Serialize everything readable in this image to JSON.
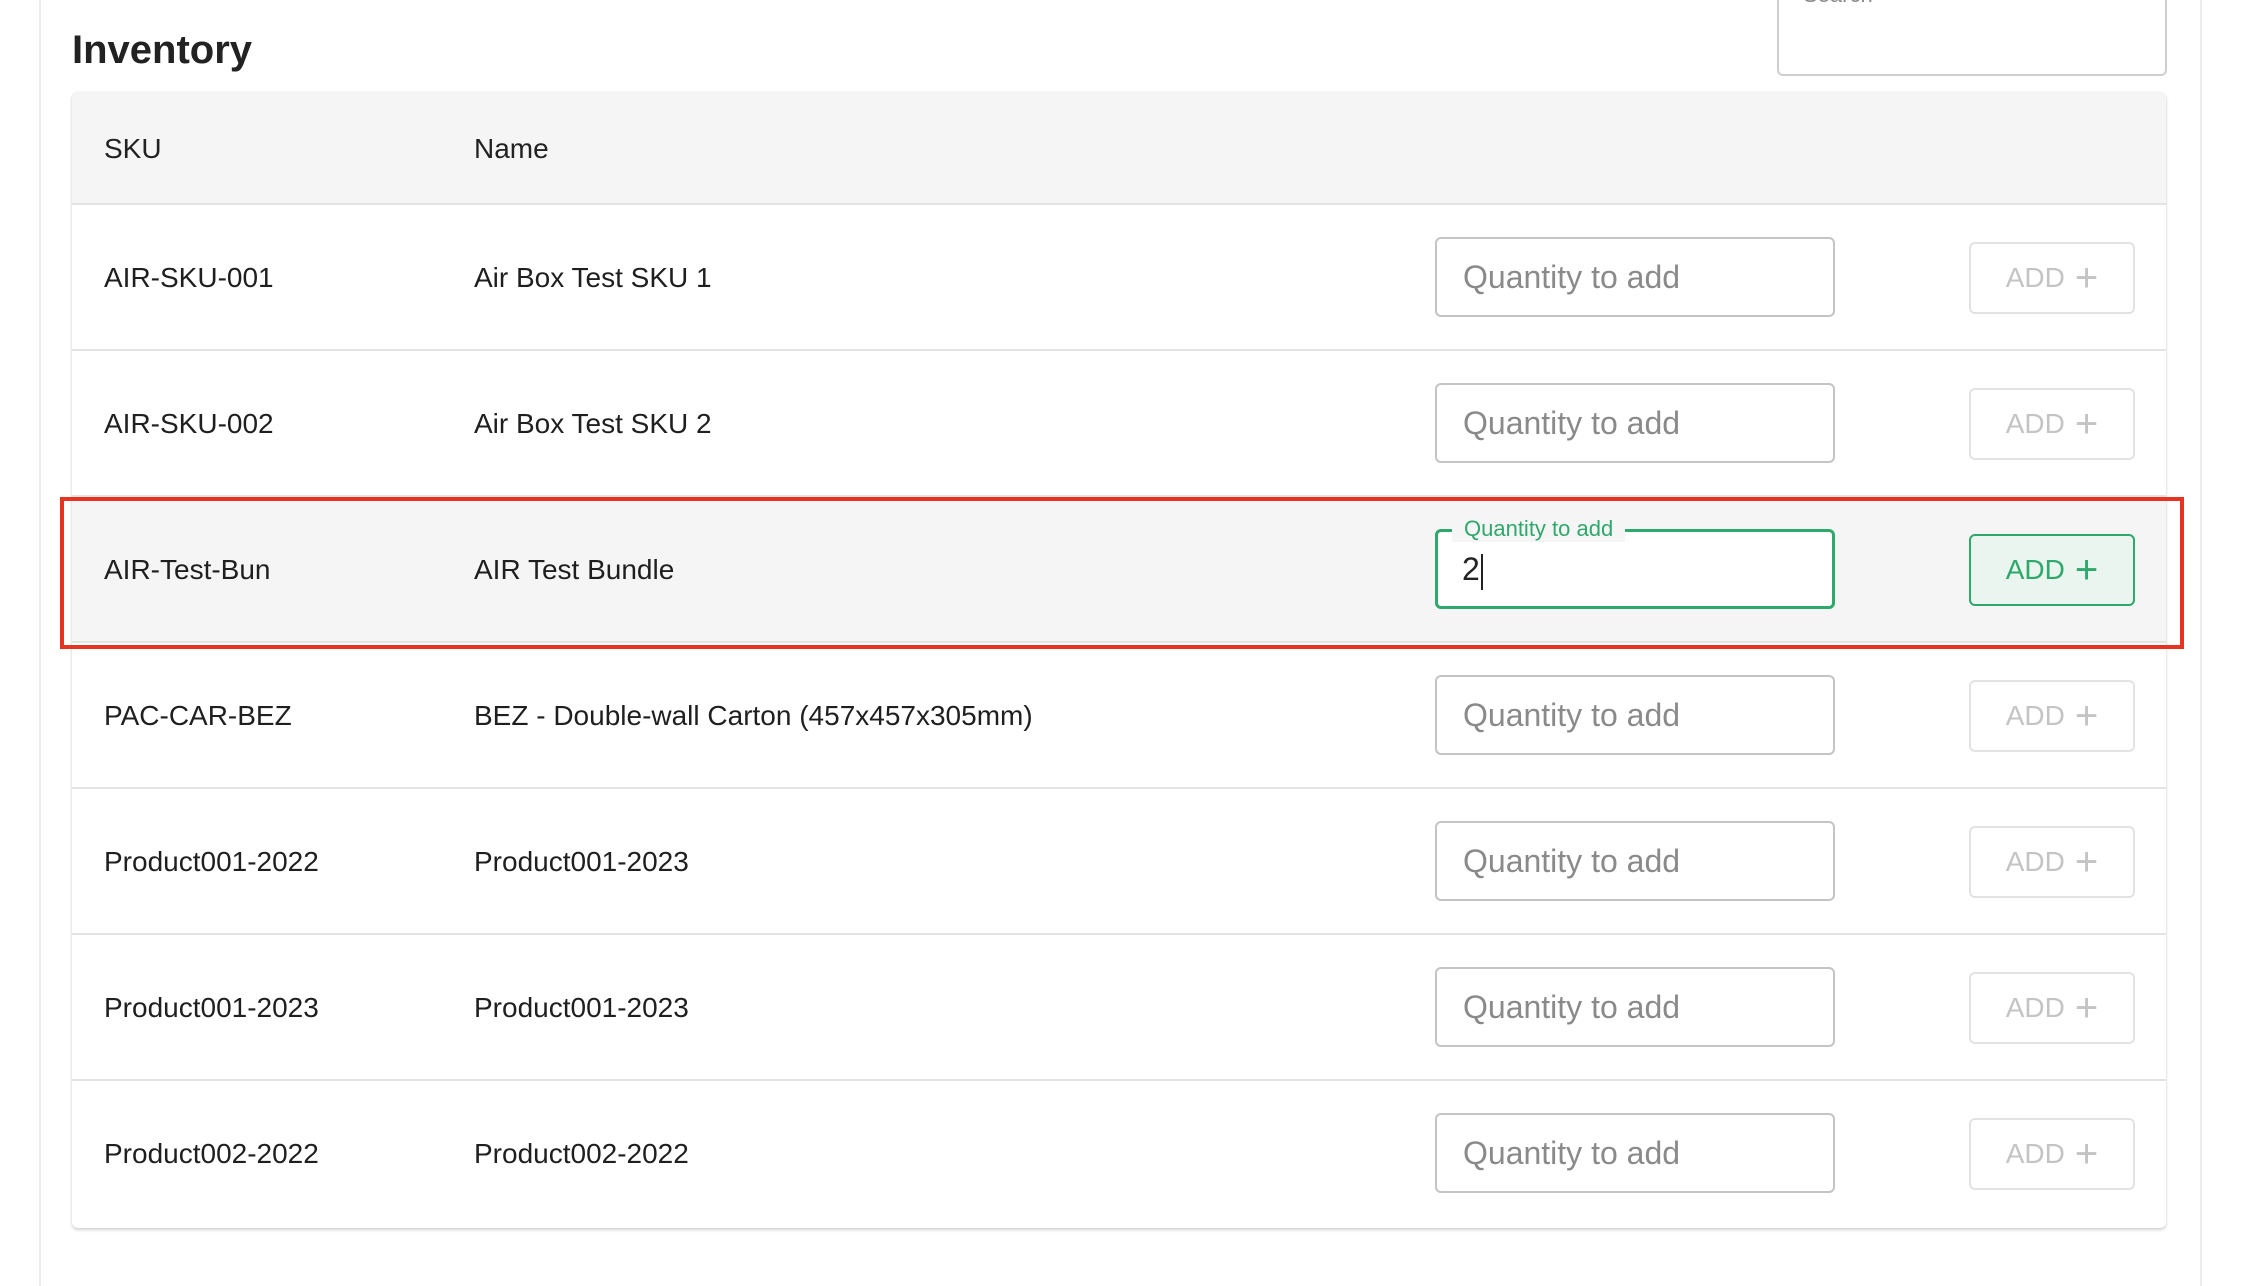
{
  "page": {
    "title": "Inventory"
  },
  "search": {
    "label": "Search"
  },
  "table": {
    "columns": {
      "sku": "SKU",
      "name": "Name"
    },
    "quantity_placeholder": "Quantity to add",
    "quantity_label": "Quantity to add",
    "add_label": "ADD",
    "rows": [
      {
        "sku": "AIR-SKU-001",
        "name": "Air Box Test SKU 1",
        "quantity": ""
      },
      {
        "sku": "AIR-SKU-002",
        "name": "Air Box Test SKU 2",
        "quantity": ""
      },
      {
        "sku": "AIR-Test-Bun",
        "name": "AIR Test Bundle",
        "quantity": "2"
      },
      {
        "sku": "PAC-CAR-BEZ",
        "name": "BEZ - Double-wall Carton (457x457x305mm)",
        "quantity": ""
      },
      {
        "sku": "Product001-2022",
        "name": "Product001-2023",
        "quantity": ""
      },
      {
        "sku": "Product001-2023",
        "name": "Product001-2023",
        "quantity": ""
      },
      {
        "sku": "Product002-2022",
        "name": "Product002-2022",
        "quantity": ""
      }
    ]
  },
  "colors": {
    "accent_green": "#2ea86b",
    "highlight_red": "#e63322",
    "disabled_text": "#c4c4c4"
  }
}
